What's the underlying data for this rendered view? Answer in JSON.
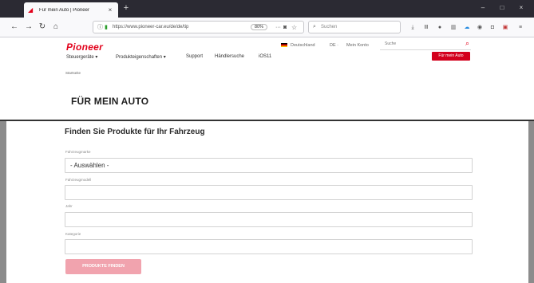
{
  "browser": {
    "tab_title": "Für mein Auto | Pioneer",
    "tab_favicon": "pioneer-favicon",
    "new_tab_label": "+",
    "close_tab_label": "×",
    "window_controls": [
      "–",
      "□",
      "×"
    ],
    "url": "https://www.pioneer-car.eu/de/de/tip",
    "zoom": "80%",
    "search_placeholder": "Suchen",
    "nav": {
      "back": "←",
      "forward": "→",
      "reload": "↻",
      "home": "⌂"
    },
    "toolbar_icons": [
      "download-icon",
      "library-icon",
      "privacy-icon",
      "shield-icon",
      "cloud-icon",
      "extension-icon",
      "sync-icon",
      "sidebar-icon",
      "addon-icon",
      "menu-icon"
    ]
  },
  "site": {
    "logo": "Pioneer",
    "util": {
      "country": "Deutschland",
      "language": "DE ·",
      "account": "Mein Konto"
    },
    "search_placeholder": "Suche",
    "nav": [
      "Steuergeräte ▾",
      "Produkteigenschaften ▾",
      "Support",
      "Händlersuche",
      "iOS11"
    ],
    "cta_label": "Für mein Auto",
    "breadcrumb": "Startseite",
    "page_title": "FÜR MEIN AUTO"
  },
  "form": {
    "title": "Finden Sie Produkte für Ihr Fahrzeug",
    "fields": [
      {
        "label": "Fahrzeugmarke",
        "value": "- Auswählen -"
      },
      {
        "label": "Fahrzeugmodell",
        "value": ""
      },
      {
        "label": "Jahr",
        "value": ""
      },
      {
        "label": "Kategorie",
        "value": ""
      }
    ],
    "submit_label": "PRODUKTE FINDEN"
  }
}
